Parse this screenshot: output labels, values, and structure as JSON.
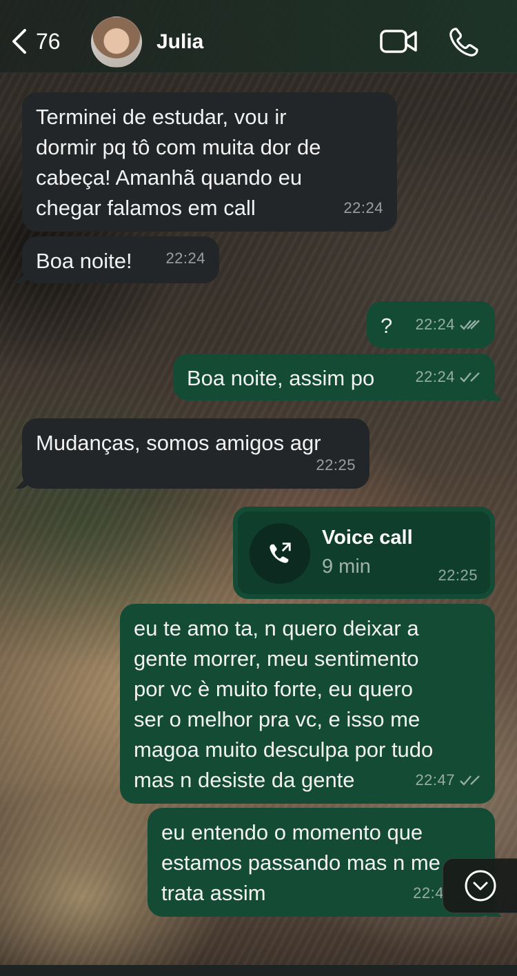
{
  "header": {
    "back_count": "76",
    "contact_name": "Julia"
  },
  "messages": [
    {
      "text": "Terminei de estudar, vou ir\ndormir pq tô com muita dor de\ncabeça! Amanhã quando eu\nchegar falamos em call",
      "time": "22:24",
      "direction": "incoming"
    },
    {
      "text": "Boa noite!",
      "time": "22:24",
      "direction": "incoming"
    },
    {
      "text": "?",
      "time": "22:24",
      "direction": "outgoing",
      "status": "read"
    },
    {
      "text": "Boa noite, assim po",
      "time": "22:24",
      "direction": "outgoing",
      "status": "read"
    },
    {
      "text": "Mudanças, somos amigos agr",
      "time": "22:25",
      "direction": "incoming"
    },
    {
      "text": "eu te amo ta, n quero deixar a\ngente morrer, meu sentimento\npor vc è muito forte, eu quero\nser o melhor pra vc, e isso me\nmagoa muito desculpa por tudo\nmas n desiste da gente",
      "time": "22:47",
      "direction": "outgoing",
      "status": "read"
    },
    {
      "text": "eu entendo o momento que\nestamos passando mas n me\ntrata assim",
      "time": "22:4",
      "direction": "outgoing"
    }
  ],
  "call": {
    "title": "Voice call",
    "duration": "9 min",
    "time": "22:25"
  },
  "colors": {
    "incoming_bubble": "#222628",
    "outgoing_bubble": "#144b35",
    "call_inner": "#0f3f2c"
  },
  "icons": [
    "chevron-left-icon",
    "video-camera-icon",
    "phone-icon",
    "outgoing-call-icon",
    "double-check-icon",
    "chevron-down-icon"
  ]
}
